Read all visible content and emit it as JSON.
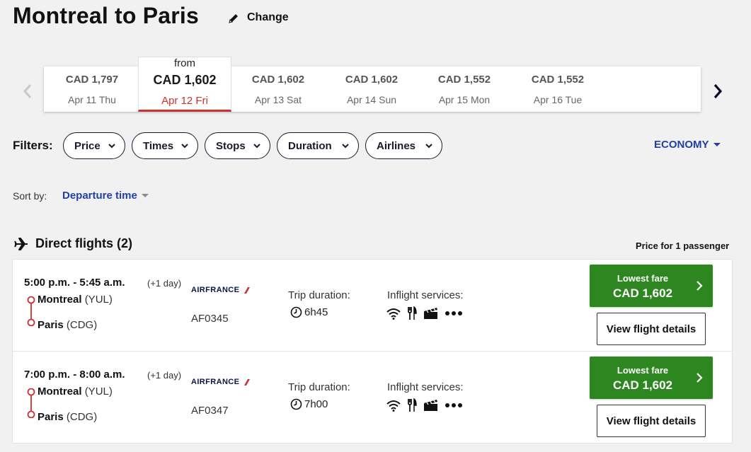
{
  "header": {
    "title": "Montreal to Paris",
    "change_label": "Change"
  },
  "date_selector": {
    "dates": [
      {
        "price": "CAD 1,797",
        "day": "Apr 11 Thu",
        "selected": false
      },
      {
        "from": "from",
        "price": "CAD 1,602",
        "day": "Apr 12 Fri",
        "selected": true
      },
      {
        "price": "CAD 1,602",
        "day": "Apr 13 Sat",
        "selected": false
      },
      {
        "price": "CAD 1,602",
        "day": "Apr 14 Sun",
        "selected": false
      },
      {
        "price": "CAD 1,552",
        "day": "Apr 15 Mon",
        "selected": false
      },
      {
        "price": "CAD 1,552",
        "day": "Apr 16 Tue",
        "selected": false
      }
    ]
  },
  "filters": {
    "label": "Filters:",
    "items": [
      "Price",
      "Times",
      "Stops",
      "Duration",
      "Airlines"
    ],
    "cabin": "ECONOMY"
  },
  "sort": {
    "label": "Sort by:",
    "value": "Departure time"
  },
  "results": {
    "heading": "Direct flights (2)",
    "price_note": "Price for 1 passenger",
    "flights": [
      {
        "times": "5:00 p.m. - 5:45 a.m.",
        "day_offset": "(+1 day)",
        "origin_city": "Montreal",
        "origin_code": "(YUL)",
        "dest_city": "Paris",
        "dest_code": "(CDG)",
        "airline": "AIRFRANCE",
        "flight_number": "AF0345",
        "trip_label": "Trip duration:",
        "duration": "6h45",
        "services_label": "Inflight services:",
        "fare_label": "Lowest fare",
        "fare_amount": "CAD 1,602",
        "details_label": "View flight details"
      },
      {
        "times": "7:00 p.m. - 8:00 a.m.",
        "day_offset": "(+1 day)",
        "origin_city": "Montreal",
        "origin_code": "(YUL)",
        "dest_city": "Paris",
        "dest_code": "(CDG)",
        "airline": "AIRFRANCE",
        "flight_number": "AF0347",
        "trip_label": "Trip duration:",
        "duration": "7h00",
        "services_label": "Inflight services:",
        "fare_label": "Lowest fare",
        "fare_amount": "CAD 1,602",
        "details_label": "View flight details"
      }
    ]
  },
  "icons": {
    "edit": "pencil-icon",
    "prev": "chevron-left-icon",
    "next": "chevron-right-icon",
    "plane": "airplane-icon",
    "clock": "clock-icon",
    "wifi": "wifi-icon",
    "meal": "cutlery-icon",
    "entertainment": "clapperboard-icon",
    "more": "more-icon"
  },
  "colors": {
    "accent_blue": "#1f3fa6",
    "fare_green": "#2e8620",
    "selected_red": "#d0302f"
  }
}
